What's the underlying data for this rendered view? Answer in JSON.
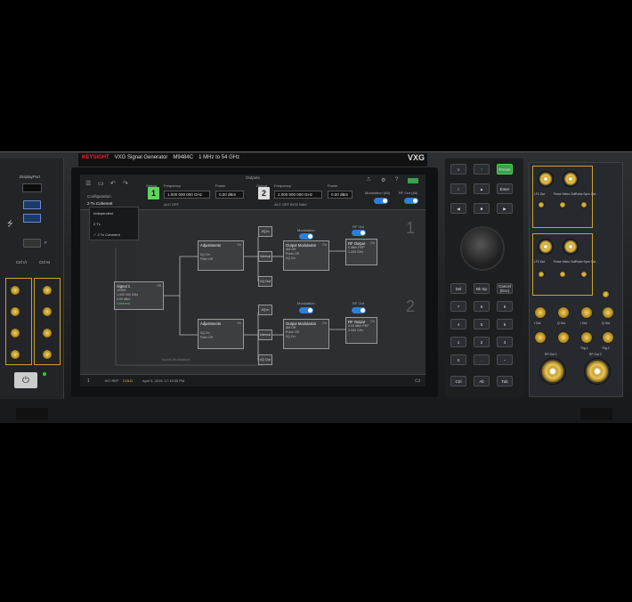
{
  "instrument": {
    "brand": "KEYSIGHT",
    "model_title": "VXG Signal Generator",
    "model_no": "M9484C",
    "range": "1 MHz to 54 GHz",
    "badge": "VXG",
    "power_symbol": "⏻"
  },
  "left_panel": {
    "displayport_label": "DisplayPort",
    "usb_symbol": "⭍",
    "usb_f_label": "F",
    "ctrl_label_1": "Ctrl\nI/I",
    "ctrl_label_2": "Ctrl\nM"
  },
  "screen": {
    "outputs_label": "Outputs",
    "config_label": "Configuration",
    "config_value": "2 Tx Coherent",
    "config_options": [
      "Independent",
      "2 Tx",
      "✓ 2 Tx Coherent"
    ],
    "output1": {
      "label": "Output",
      "number": "1",
      "frequency_label": "Frequency",
      "frequency": "1.000 000 000 GHz",
      "power_label": "Power",
      "power": "0.00 dBm",
      "sub": "ALC OFF"
    },
    "output2": {
      "label": "Output",
      "number": "2",
      "frequency_label": "Frequency",
      "frequency": "2.000 000 000 GHz",
      "power_label": "Power",
      "power": "0.00 dBm",
      "sub": "ALC OFF   INTE   MAC"
    },
    "modulation_label": "Modulation (All)",
    "rf_out_label": "RF Out (All)",
    "signal1": {
      "title": "Signal 1",
      "on": "Off",
      "lines": [
        "1GHM",
        "1.000 000 GHz",
        "0.00 dBm"
      ],
      "status": "Coherent"
    },
    "channel1": {
      "adjustments_title": "Adjustments",
      "adjustments_on": "On",
      "adj_lines": [
        "I/Q    On",
        "Filter Off"
      ],
      "iq_in": "I/Q In",
      "internal": "Internal",
      "iq_out": "I/Q Out",
      "modulation_label": "Modulation",
      "om_title": "Output Modulation",
      "om_on": "On",
      "om_lines": [
        "AM     Off",
        "Pulse  Off",
        "I/Q    On"
      ],
      "rf_label": "RF Out",
      "rf_title": "RF Output",
      "rf_on": "On",
      "rf_lines": [
        "0 dBm PEP",
        "1.000 GHz"
      ],
      "big": "1"
    },
    "channel2": {
      "adjustments_title": "Adjustments",
      "adjustments_on": "On",
      "adj_lines": [
        "I/Q    On",
        "Filter Off"
      ],
      "iq_in": "I/Q In",
      "internal": "Internal",
      "iq_out": "I/Q Out",
      "modulation_label": "Modulation",
      "om_title": "Output Modulation",
      "om_on": "On",
      "om_lines": [
        "AM     Off",
        "Pulse  Off",
        "I/Q    On"
      ],
      "rf_label": "RF Out",
      "rf_title": "RF Output",
      "rf_on": "On",
      "rf_lines": [
        "0.00 dBm PEP",
        "2.000 GHz"
      ],
      "big": "2"
    },
    "multi_label": "Inputs Modulation",
    "status_bar": {
      "left": "1",
      "a": "INT REF",
      "b": "COLD",
      "datetime": "April 9, 2019, 17:19:35 PM"
    }
  },
  "keypad": {
    "row0": [
      "≡",
      "?",
      "Preset"
    ],
    "row1": [
      "○",
      "▲",
      "Enter"
    ],
    "row2": [
      "◀",
      "■",
      "▶"
    ],
    "cancel": "Cancel\n(Esc)",
    "keys": [
      "Del",
      "Bk Sp",
      "Cancel (Esc)",
      "7",
      "8",
      "9",
      "4",
      "5",
      "6",
      "1",
      "2",
      "3",
      "0",
      ".",
      "−",
      "Ctrl",
      "Alt",
      "Tab"
    ]
  },
  "right_panel": {
    "labels": [
      "LF1 Out",
      "Pulse Video Out",
      "Pulse Sync Out",
      "LF2 Out",
      "Pulse Video Out",
      "Pulse Sync Out",
      "I Out",
      "Q Out",
      "I Out",
      "Q Out",
      "Trig 1",
      "Trig 2",
      "RF Out 1",
      "RF Out 2"
    ]
  },
  "colors": {
    "accent_blue": "#2f7fd8",
    "output1_green": "#5fd35f",
    "preset_green": "#3aa14a",
    "brand_red": "#e23"
  }
}
